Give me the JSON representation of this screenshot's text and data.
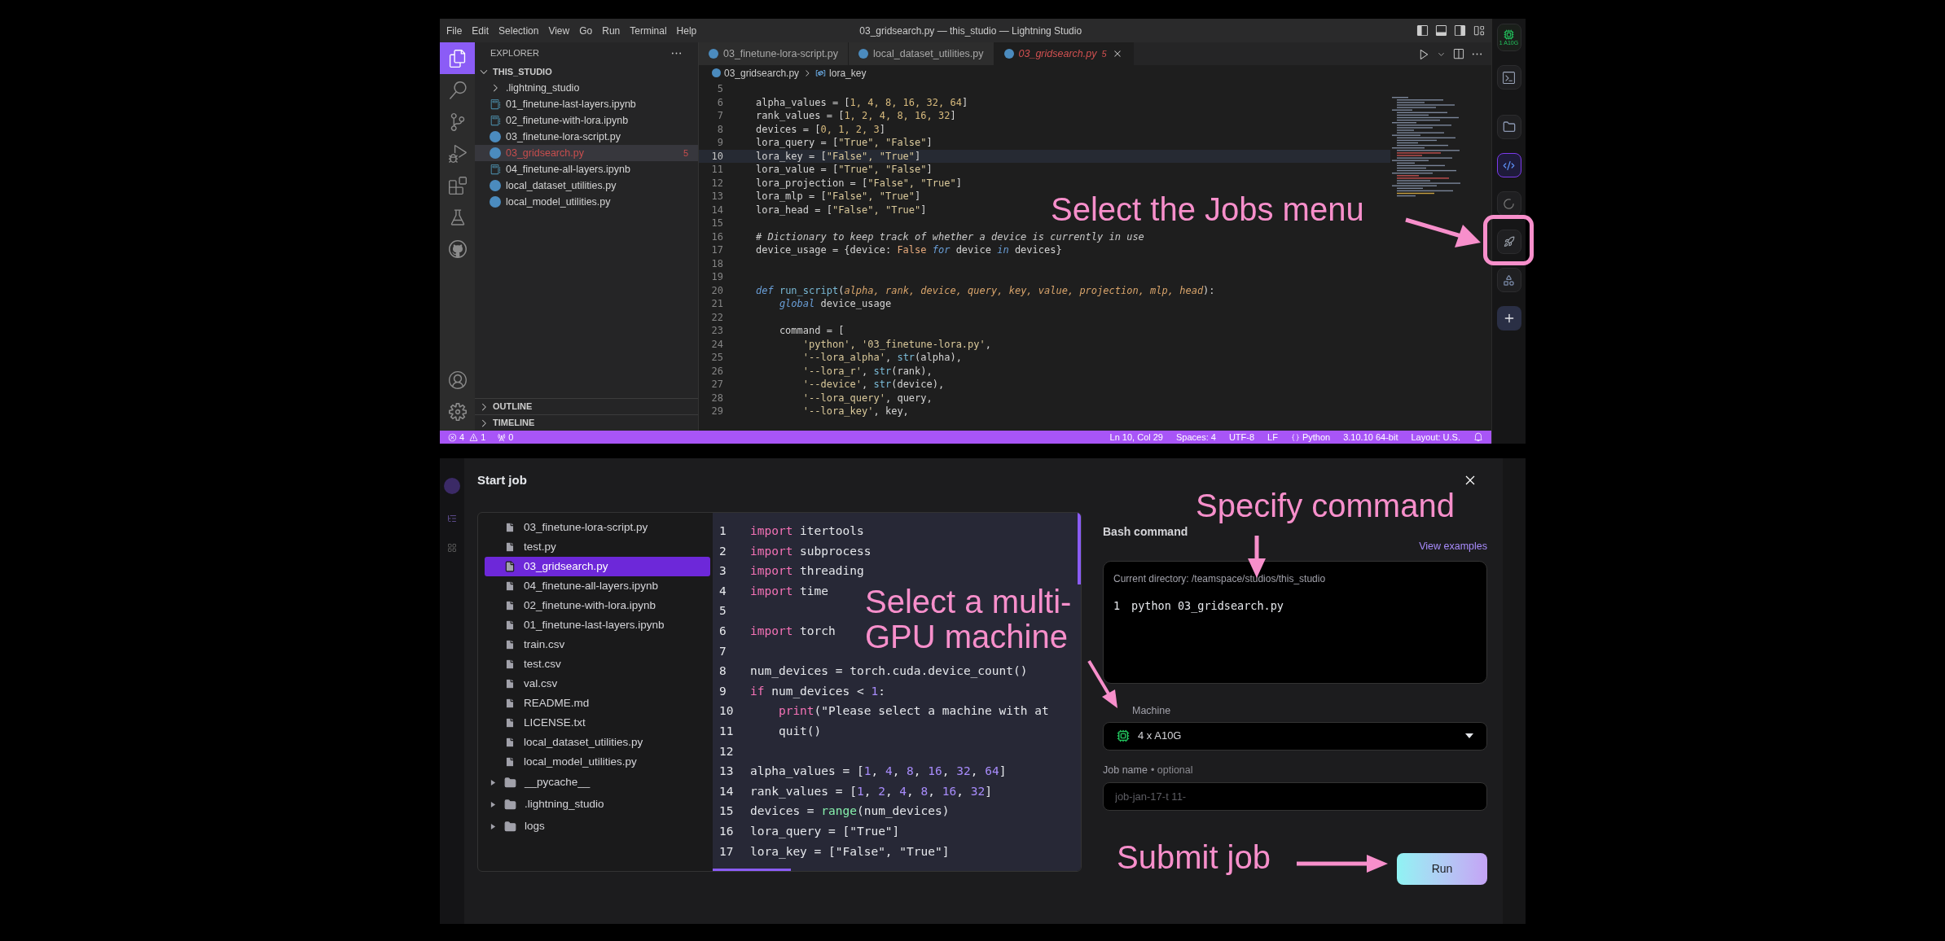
{
  "menu": [
    "File",
    "Edit",
    "Selection",
    "View",
    "Go",
    "Run",
    "Terminal",
    "Help"
  ],
  "window_title": "03_gridsearch.py — this_studio — Lightning Studio",
  "activity_bar": {
    "top": [
      {
        "kind": "files",
        "selected": true
      },
      {
        "kind": "search",
        "selected": false
      },
      {
        "kind": "source_control",
        "selected": false
      },
      {
        "kind": "run",
        "selected": false
      },
      {
        "kind": "extensions",
        "selected": false
      },
      {
        "kind": "testing",
        "selected": false
      },
      {
        "kind": "github",
        "selected": false
      }
    ],
    "bottom": [
      {
        "kind": "account",
        "selected": false
      },
      {
        "kind": "settings",
        "selected": false
      }
    ]
  },
  "explorer": {
    "title": "EXPLORER",
    "root": "THIS_STUDIO",
    "root_expanded": true,
    "items": [
      {
        "label": ".lightning_studio",
        "kind": "folder",
        "expanded": false,
        "selected": false,
        "error": false
      },
      {
        "label": "01_finetune-last-layers.ipynb",
        "kind": "notebook",
        "selected": false,
        "error": false
      },
      {
        "label": "02_finetune-with-lora.ipynb",
        "kind": "notebook",
        "selected": false,
        "error": false
      },
      {
        "label": "03_finetune-lora-script.py",
        "kind": "python",
        "selected": false,
        "error": false
      },
      {
        "label": "03_gridsearch.py",
        "kind": "python",
        "selected": true,
        "error": true,
        "badge": "5"
      },
      {
        "label": "04_finetune-all-layers.ipynb",
        "kind": "notebook",
        "selected": false,
        "error": false
      },
      {
        "label": "local_dataset_utilities.py",
        "kind": "python",
        "selected": false,
        "error": false
      },
      {
        "label": "local_model_utilities.py",
        "kind": "python",
        "selected": false,
        "error": false
      }
    ],
    "sections": [
      {
        "label": "OUTLINE",
        "expanded": false
      },
      {
        "label": "TIMELINE",
        "expanded": false
      }
    ]
  },
  "tabs": [
    {
      "label": "03_finetune-lora-script.py",
      "selected": false,
      "error": false
    },
    {
      "label": "local_dataset_utilities.py",
      "selected": false,
      "error": false
    },
    {
      "label": "03_gridsearch.py",
      "selected": true,
      "error": true,
      "badge": "5"
    }
  ],
  "breadcrumb": [
    "03_gridsearch.py",
    "lora_key"
  ],
  "editor": {
    "lines": [
      {
        "number": "5",
        "current": false
      },
      {
        "number": "6",
        "current": false,
        "tokens": [
          {
            "text": "alpha_values = [",
            "kind": "plain"
          },
          {
            "text": "1, 4, 8, 16, 32, 64",
            "kind": "number"
          },
          {
            "text": "]",
            "kind": "plain"
          }
        ]
      },
      {
        "number": "7",
        "current": false,
        "tokens": [
          {
            "text": "rank_values = [",
            "kind": "plain"
          },
          {
            "text": "1, 2, 4, 8, 16, 32",
            "kind": "number"
          },
          {
            "text": "]",
            "kind": "plain"
          }
        ]
      },
      {
        "number": "8",
        "current": false,
        "tokens": [
          {
            "text": "devices = [",
            "kind": "plain"
          },
          {
            "text": "0, 1, 2, 3",
            "kind": "number"
          },
          {
            "text": "]",
            "kind": "plain"
          }
        ]
      },
      {
        "number": "9",
        "current": false,
        "tokens": [
          {
            "text": "lora_query = [",
            "kind": "plain"
          },
          {
            "text": "\"True\", \"False\"",
            "kind": "string"
          },
          {
            "text": "]",
            "kind": "plain"
          }
        ]
      },
      {
        "number": "10",
        "current": true,
        "tokens": [
          {
            "text": "lora_key = [",
            "kind": "plain"
          },
          {
            "text": "\"False\", \"True\"",
            "kind": "string"
          },
          {
            "text": "]",
            "kind": "plain"
          }
        ]
      },
      {
        "number": "11",
        "current": false,
        "tokens": [
          {
            "text": "lora_value = [",
            "kind": "plain"
          },
          {
            "text": "\"True\", \"False\"",
            "kind": "string"
          },
          {
            "text": "]",
            "kind": "plain"
          }
        ]
      },
      {
        "number": "12",
        "current": false,
        "tokens": [
          {
            "text": "lora_projection = [",
            "kind": "plain"
          },
          {
            "text": "\"False\", \"True\"",
            "kind": "string"
          },
          {
            "text": "]",
            "kind": "plain"
          }
        ]
      },
      {
        "number": "13",
        "current": false,
        "tokens": [
          {
            "text": "lora_mlp = [",
            "kind": "plain"
          },
          {
            "text": "\"False\", \"True\"",
            "kind": "string"
          },
          {
            "text": "]",
            "kind": "plain"
          }
        ]
      },
      {
        "number": "14",
        "current": false,
        "tokens": [
          {
            "text": "lora_head = [",
            "kind": "plain"
          },
          {
            "text": "\"False\", \"True\"",
            "kind": "string"
          },
          {
            "text": "]",
            "kind": "plain"
          }
        ]
      },
      {
        "number": "15",
        "current": false
      },
      {
        "number": "16",
        "current": false,
        "tokens": [
          {
            "text": "# Dictionary to keep track of whether a device is currently in use",
            "kind": "comment"
          }
        ]
      },
      {
        "number": "17",
        "current": false,
        "tokens": [
          {
            "text": "device_usage = {device: ",
            "kind": "plain"
          },
          {
            "text": "False",
            "kind": "constant"
          },
          {
            "text": " for",
            "kind": "keyword"
          },
          {
            "text": " device ",
            "kind": "plain"
          },
          {
            "text": "in",
            "kind": "keyword"
          },
          {
            "text": " devices}",
            "kind": "plain"
          }
        ]
      },
      {
        "number": "18",
        "current": false
      },
      {
        "number": "19",
        "current": false
      },
      {
        "number": "20",
        "current": false,
        "tokens": [
          {
            "text": "def",
            "kind": "keyword"
          },
          {
            "text": " run_script",
            "kind": "function"
          },
          {
            "text": "(",
            "kind": "plain"
          },
          {
            "text": "alpha, rank, device, query, key, value, projection, mlp, head",
            "kind": "param"
          },
          {
            "text": "):",
            "kind": "plain"
          }
        ]
      },
      {
        "number": "21",
        "current": false,
        "tokens": [
          {
            "text": "    global",
            "kind": "keyword"
          },
          {
            "text": " device_usage",
            "kind": "plain"
          }
        ]
      },
      {
        "number": "22",
        "current": false
      },
      {
        "number": "23",
        "current": false,
        "tokens": [
          {
            "text": "    command = [",
            "kind": "plain"
          }
        ]
      },
      {
        "number": "24",
        "current": false,
        "tokens": [
          {
            "text": "        'python', '03_finetune-lora.py'",
            "kind": "string"
          },
          {
            "text": ",",
            "kind": "plain"
          }
        ]
      },
      {
        "number": "25",
        "current": false,
        "tokens": [
          {
            "text": "        '--lora_alpha'",
            "kind": "string"
          },
          {
            "text": ", ",
            "kind": "plain"
          },
          {
            "text": "str",
            "kind": "function"
          },
          {
            "text": "(alpha),",
            "kind": "plain"
          }
        ]
      },
      {
        "number": "26",
        "current": false,
        "tokens": [
          {
            "text": "        '--lora_r'",
            "kind": "string"
          },
          {
            "text": ", ",
            "kind": "plain"
          },
          {
            "text": "str",
            "kind": "function"
          },
          {
            "text": "(rank),",
            "kind": "plain"
          }
        ]
      },
      {
        "number": "27",
        "current": false,
        "tokens": [
          {
            "text": "        '--device'",
            "kind": "string"
          },
          {
            "text": ", ",
            "kind": "plain"
          },
          {
            "text": "str",
            "kind": "function"
          },
          {
            "text": "(device),",
            "kind": "plain"
          }
        ]
      },
      {
        "number": "28",
        "current": false,
        "tokens": [
          {
            "text": "        '--lora_query'",
            "kind": "string"
          },
          {
            "text": ", query,",
            "kind": "plain"
          }
        ]
      },
      {
        "number": "29",
        "current": false,
        "tokens": [
          {
            "text": "        '--lora_key'",
            "kind": "string"
          },
          {
            "text": ", key,",
            "kind": "plain"
          }
        ]
      }
    ]
  },
  "status_bar": {
    "errors": "4",
    "warnings": "1",
    "ports": "0",
    "items": [
      {
        "text": "Ln 10, Col 29",
        "kind": "plain"
      },
      {
        "text": "Spaces: 4",
        "kind": "plain"
      },
      {
        "text": "UTF-8",
        "kind": "plain"
      },
      {
        "text": "LF",
        "kind": "plain"
      },
      {
        "text": "Python",
        "kind": "language"
      },
      {
        "text": "3.10.10 64-bit",
        "kind": "plain"
      },
      {
        "text": "Layout: U.S.",
        "kind": "plain"
      }
    ]
  },
  "studio_bar": {
    "machine": "1 A10G",
    "tools": [
      {
        "kind": "terminal",
        "selected": false
      },
      {
        "kind": "folder",
        "selected": false
      },
      {
        "kind": "vscode",
        "selected": true
      },
      {
        "kind": "loader",
        "selected": false
      },
      {
        "kind": "rocket",
        "selected": false
      },
      {
        "kind": "model",
        "selected": false
      },
      {
        "kind": "plus",
        "selected": false
      }
    ]
  },
  "job_dialog": {
    "title": "Start job",
    "files": [
      {
        "label": "03_finetune-lora-script.py",
        "kind": "file",
        "selected": false
      },
      {
        "label": "test.py",
        "kind": "file",
        "selected": false
      },
      {
        "label": "03_gridsearch.py",
        "kind": "file",
        "selected": true
      },
      {
        "label": "04_finetune-all-layers.ipynb",
        "kind": "file",
        "selected": false
      },
      {
        "label": "02_finetune-with-lora.ipynb",
        "kind": "file",
        "selected": false
      },
      {
        "label": "01_finetune-last-layers.ipynb",
        "kind": "file",
        "selected": false
      },
      {
        "label": "train.csv",
        "kind": "file",
        "selected": false
      },
      {
        "label": "test.csv",
        "kind": "file",
        "selected": false
      },
      {
        "label": "val.csv",
        "kind": "file",
        "selected": false
      },
      {
        "label": "README.md",
        "kind": "file",
        "selected": false
      },
      {
        "label": "LICENSE.txt",
        "kind": "file",
        "selected": false
      },
      {
        "label": "local_dataset_utilities.py",
        "kind": "file",
        "selected": false
      },
      {
        "label": "local_model_utilities.py",
        "kind": "file",
        "selected": false
      },
      {
        "label": "__pycache__",
        "kind": "folder",
        "selected": false,
        "expanded": false
      },
      {
        "label": ".lightning_studio",
        "kind": "folder",
        "selected": false,
        "expanded": false
      },
      {
        "label": "logs",
        "kind": "folder",
        "selected": false,
        "expanded": false
      }
    ],
    "code": [
      {
        "number": "1",
        "tokens": [
          {
            "text": "import",
            "kind": "keyword"
          },
          {
            "text": " itertools",
            "kind": "plain"
          }
        ]
      },
      {
        "number": "2",
        "tokens": [
          {
            "text": "import",
            "kind": "keyword"
          },
          {
            "text": " subprocess",
            "kind": "plain"
          }
        ]
      },
      {
        "number": "3",
        "tokens": [
          {
            "text": "import",
            "kind": "keyword"
          },
          {
            "text": " threading",
            "kind": "plain"
          }
        ]
      },
      {
        "number": "4",
        "tokens": [
          {
            "text": "import",
            "kind": "keyword"
          },
          {
            "text": " time",
            "kind": "plain"
          }
        ]
      },
      {
        "number": "5"
      },
      {
        "number": "6",
        "tokens": [
          {
            "text": "import",
            "kind": "keyword"
          },
          {
            "text": " torch",
            "kind": "plain"
          }
        ]
      },
      {
        "number": "7"
      },
      {
        "number": "8",
        "tokens": [
          {
            "text": "num_devices = torch.cuda.device_count()",
            "kind": "plain"
          }
        ]
      },
      {
        "number": "9",
        "tokens": [
          {
            "text": "if",
            "kind": "keyword"
          },
          {
            "text": " num_devices < ",
            "kind": "plain"
          },
          {
            "text": "1",
            "kind": "number"
          },
          {
            "text": ":",
            "kind": "plain"
          }
        ]
      },
      {
        "number": "10",
        "tokens": [
          {
            "text": "    print",
            "kind": "keyword"
          },
          {
            "text": "(\"Please select a machine with at",
            "kind": "plain"
          }
        ]
      },
      {
        "number": "11",
        "tokens": [
          {
            "text": "    quit()",
            "kind": "plain"
          }
        ]
      },
      {
        "number": "12"
      },
      {
        "number": "13",
        "tokens": [
          {
            "text": "alpha_values = [",
            "kind": "plain"
          },
          {
            "text": "1",
            "kind": "number"
          },
          {
            "text": ", ",
            "kind": "plain"
          },
          {
            "text": "4",
            "kind": "number"
          },
          {
            "text": ", ",
            "kind": "plain"
          },
          {
            "text": "8",
            "kind": "number"
          },
          {
            "text": ", ",
            "kind": "plain"
          },
          {
            "text": "16",
            "kind": "number"
          },
          {
            "text": ", ",
            "kind": "plain"
          },
          {
            "text": "32",
            "kind": "number"
          },
          {
            "text": ", ",
            "kind": "plain"
          },
          {
            "text": "64",
            "kind": "number"
          },
          {
            "text": "]",
            "kind": "plain"
          }
        ]
      },
      {
        "number": "14",
        "tokens": [
          {
            "text": "rank_values = [",
            "kind": "plain"
          },
          {
            "text": "1",
            "kind": "number"
          },
          {
            "text": ", ",
            "kind": "plain"
          },
          {
            "text": "2",
            "kind": "number"
          },
          {
            "text": ", ",
            "kind": "plain"
          },
          {
            "text": "4",
            "kind": "number"
          },
          {
            "text": ", ",
            "kind": "plain"
          },
          {
            "text": "8",
            "kind": "number"
          },
          {
            "text": ", ",
            "kind": "plain"
          },
          {
            "text": "16",
            "kind": "number"
          },
          {
            "text": ", ",
            "kind": "plain"
          },
          {
            "text": "32",
            "kind": "number"
          },
          {
            "text": "]",
            "kind": "plain"
          }
        ]
      },
      {
        "number": "15",
        "tokens": [
          {
            "text": "devices = ",
            "kind": "plain"
          },
          {
            "text": "range",
            "kind": "function"
          },
          {
            "text": "(num_devices)",
            "kind": "plain"
          }
        ]
      },
      {
        "number": "16",
        "tokens": [
          {
            "text": "lora_query = [\"True\"]",
            "kind": "plain"
          }
        ]
      },
      {
        "number": "17",
        "tokens": [
          {
            "text": "lora_key = [\"False\", \"True\"]",
            "kind": "plain"
          }
        ]
      }
    ],
    "bash_label": "Bash command",
    "examples_link": "View examples",
    "current_directory": "Current directory: /teamspace/studios/this_studio",
    "command_lines": [
      {
        "number": "1",
        "text": "python 03_gridsearch.py"
      }
    ],
    "machine_label": "Machine",
    "machine": "4 x A10G",
    "job_name_label": "Job name",
    "job_name_hint": "• optional",
    "job_name_placeholder": "job-jan-17-t 11-",
    "run_button": "Run"
  },
  "annotations": [
    {
      "lines": [
        "Select the Jobs menu"
      ]
    },
    {
      "lines": [
        "Specify command"
      ]
    },
    {
      "lines": [
        "Select a multi-",
        "GPU machine"
      ]
    },
    {
      "lines": [
        "Submit job"
      ]
    }
  ]
}
